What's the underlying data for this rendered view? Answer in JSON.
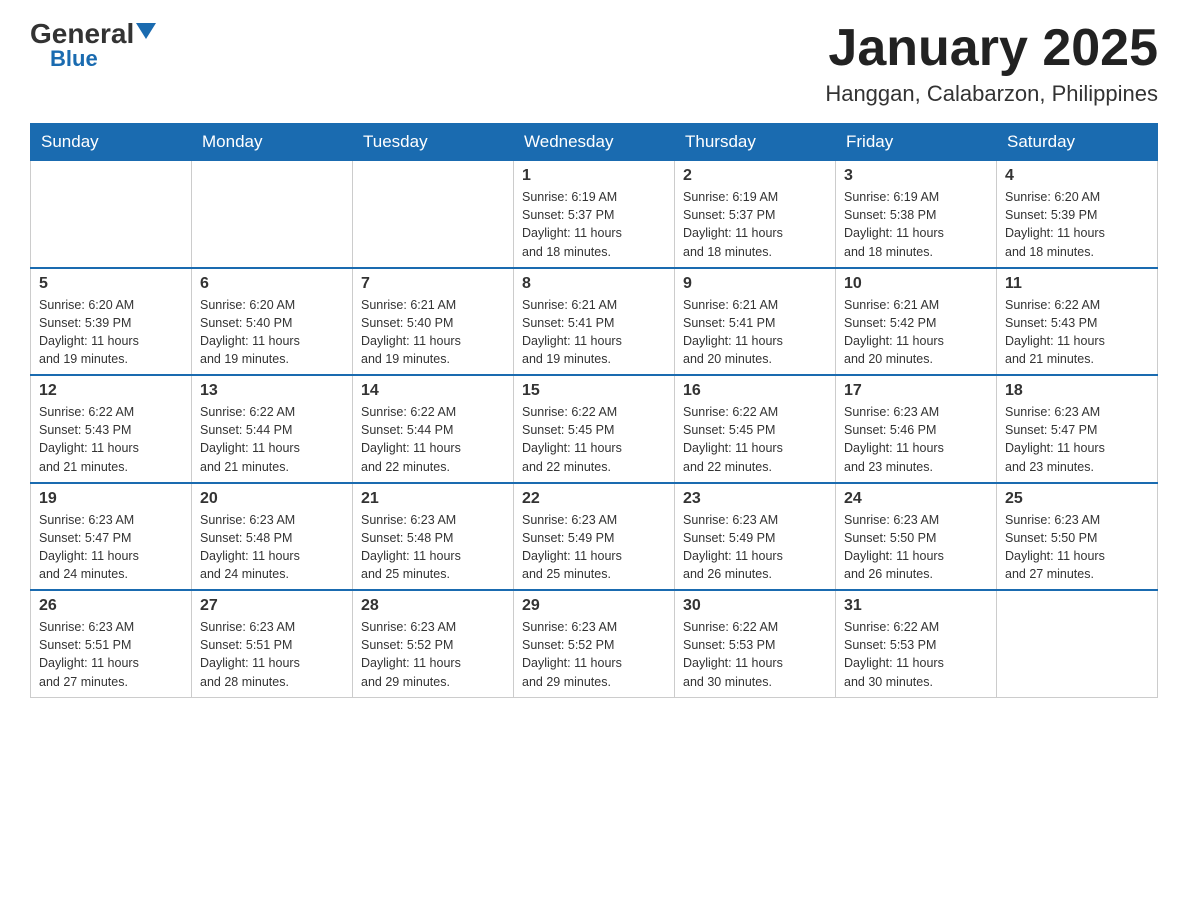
{
  "header": {
    "logo_general": "General",
    "logo_blue": "Blue",
    "month_title": "January 2025",
    "location": "Hanggan, Calabarzon, Philippines"
  },
  "days_of_week": [
    "Sunday",
    "Monday",
    "Tuesday",
    "Wednesday",
    "Thursday",
    "Friday",
    "Saturday"
  ],
  "weeks": [
    [
      {
        "day": "",
        "info": ""
      },
      {
        "day": "",
        "info": ""
      },
      {
        "day": "",
        "info": ""
      },
      {
        "day": "1",
        "info": "Sunrise: 6:19 AM\nSunset: 5:37 PM\nDaylight: 11 hours\nand 18 minutes."
      },
      {
        "day": "2",
        "info": "Sunrise: 6:19 AM\nSunset: 5:37 PM\nDaylight: 11 hours\nand 18 minutes."
      },
      {
        "day": "3",
        "info": "Sunrise: 6:19 AM\nSunset: 5:38 PM\nDaylight: 11 hours\nand 18 minutes."
      },
      {
        "day": "4",
        "info": "Sunrise: 6:20 AM\nSunset: 5:39 PM\nDaylight: 11 hours\nand 18 minutes."
      }
    ],
    [
      {
        "day": "5",
        "info": "Sunrise: 6:20 AM\nSunset: 5:39 PM\nDaylight: 11 hours\nand 19 minutes."
      },
      {
        "day": "6",
        "info": "Sunrise: 6:20 AM\nSunset: 5:40 PM\nDaylight: 11 hours\nand 19 minutes."
      },
      {
        "day": "7",
        "info": "Sunrise: 6:21 AM\nSunset: 5:40 PM\nDaylight: 11 hours\nand 19 minutes."
      },
      {
        "day": "8",
        "info": "Sunrise: 6:21 AM\nSunset: 5:41 PM\nDaylight: 11 hours\nand 19 minutes."
      },
      {
        "day": "9",
        "info": "Sunrise: 6:21 AM\nSunset: 5:41 PM\nDaylight: 11 hours\nand 20 minutes."
      },
      {
        "day": "10",
        "info": "Sunrise: 6:21 AM\nSunset: 5:42 PM\nDaylight: 11 hours\nand 20 minutes."
      },
      {
        "day": "11",
        "info": "Sunrise: 6:22 AM\nSunset: 5:43 PM\nDaylight: 11 hours\nand 21 minutes."
      }
    ],
    [
      {
        "day": "12",
        "info": "Sunrise: 6:22 AM\nSunset: 5:43 PM\nDaylight: 11 hours\nand 21 minutes."
      },
      {
        "day": "13",
        "info": "Sunrise: 6:22 AM\nSunset: 5:44 PM\nDaylight: 11 hours\nand 21 minutes."
      },
      {
        "day": "14",
        "info": "Sunrise: 6:22 AM\nSunset: 5:44 PM\nDaylight: 11 hours\nand 22 minutes."
      },
      {
        "day": "15",
        "info": "Sunrise: 6:22 AM\nSunset: 5:45 PM\nDaylight: 11 hours\nand 22 minutes."
      },
      {
        "day": "16",
        "info": "Sunrise: 6:22 AM\nSunset: 5:45 PM\nDaylight: 11 hours\nand 22 minutes."
      },
      {
        "day": "17",
        "info": "Sunrise: 6:23 AM\nSunset: 5:46 PM\nDaylight: 11 hours\nand 23 minutes."
      },
      {
        "day": "18",
        "info": "Sunrise: 6:23 AM\nSunset: 5:47 PM\nDaylight: 11 hours\nand 23 minutes."
      }
    ],
    [
      {
        "day": "19",
        "info": "Sunrise: 6:23 AM\nSunset: 5:47 PM\nDaylight: 11 hours\nand 24 minutes."
      },
      {
        "day": "20",
        "info": "Sunrise: 6:23 AM\nSunset: 5:48 PM\nDaylight: 11 hours\nand 24 minutes."
      },
      {
        "day": "21",
        "info": "Sunrise: 6:23 AM\nSunset: 5:48 PM\nDaylight: 11 hours\nand 25 minutes."
      },
      {
        "day": "22",
        "info": "Sunrise: 6:23 AM\nSunset: 5:49 PM\nDaylight: 11 hours\nand 25 minutes."
      },
      {
        "day": "23",
        "info": "Sunrise: 6:23 AM\nSunset: 5:49 PM\nDaylight: 11 hours\nand 26 minutes."
      },
      {
        "day": "24",
        "info": "Sunrise: 6:23 AM\nSunset: 5:50 PM\nDaylight: 11 hours\nand 26 minutes."
      },
      {
        "day": "25",
        "info": "Sunrise: 6:23 AM\nSunset: 5:50 PM\nDaylight: 11 hours\nand 27 minutes."
      }
    ],
    [
      {
        "day": "26",
        "info": "Sunrise: 6:23 AM\nSunset: 5:51 PM\nDaylight: 11 hours\nand 27 minutes."
      },
      {
        "day": "27",
        "info": "Sunrise: 6:23 AM\nSunset: 5:51 PM\nDaylight: 11 hours\nand 28 minutes."
      },
      {
        "day": "28",
        "info": "Sunrise: 6:23 AM\nSunset: 5:52 PM\nDaylight: 11 hours\nand 29 minutes."
      },
      {
        "day": "29",
        "info": "Sunrise: 6:23 AM\nSunset: 5:52 PM\nDaylight: 11 hours\nand 29 minutes."
      },
      {
        "day": "30",
        "info": "Sunrise: 6:22 AM\nSunset: 5:53 PM\nDaylight: 11 hours\nand 30 minutes."
      },
      {
        "day": "31",
        "info": "Sunrise: 6:22 AM\nSunset: 5:53 PM\nDaylight: 11 hours\nand 30 minutes."
      },
      {
        "day": "",
        "info": ""
      }
    ]
  ]
}
